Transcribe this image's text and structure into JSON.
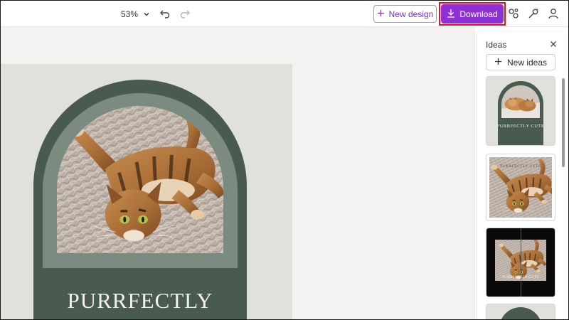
{
  "toolbar": {
    "zoom_value": "53%",
    "new_design_label": "New design",
    "download_label": "Download",
    "icons": [
      "chevron-down-icon",
      "undo-icon",
      "redo-icon",
      "plus-icon",
      "download-icon",
      "share-icon",
      "magic-icon",
      "profile-icon"
    ]
  },
  "design": {
    "title": "PURRFECTLY"
  },
  "ideas": {
    "title": "Ideas",
    "new_ideas_label": "New ideas",
    "thumbnails": [
      {
        "caption": "PURRFECTLY CUTE"
      },
      {
        "caption": "PURRFECTLY CUTE"
      },
      {
        "caption": "PURRFECTLY CUTE"
      },
      {
        "caption": ""
      }
    ]
  },
  "colors": {
    "accent": "#8f2fd6",
    "highlight_box": "#e0141b",
    "arch_green": "#485b4e",
    "canvas_bg": "#f3f2f1"
  }
}
